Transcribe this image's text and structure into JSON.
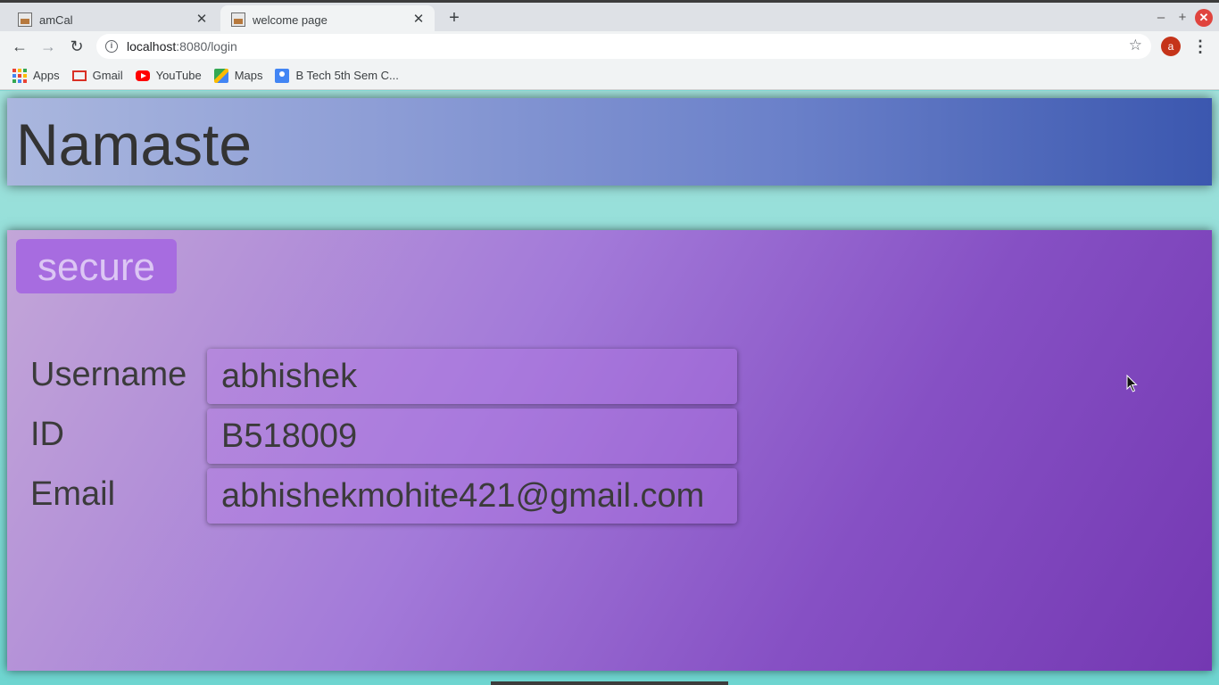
{
  "browser": {
    "tabs": [
      {
        "title": "amCal",
        "active": false
      },
      {
        "title": "welcome page",
        "active": true
      }
    ],
    "url_host": "localhost",
    "url_path": ":8080/login",
    "profile_initial": "a",
    "bookmarks": [
      {
        "label": "Apps",
        "icon": "apps-grid-icon"
      },
      {
        "label": "Gmail",
        "icon": "gmail-icon"
      },
      {
        "label": "YouTube",
        "icon": "youtube-icon"
      },
      {
        "label": "Maps",
        "icon": "maps-icon"
      },
      {
        "label": "B Tech 5th Sem C...",
        "icon": "classroom-icon"
      }
    ]
  },
  "page": {
    "banner_title": "Namaste",
    "badge_label": "secure",
    "form": {
      "username_label": "Username",
      "username_value": "abhishek",
      "id_label": "ID",
      "id_value": "B518009",
      "email_label": "Email",
      "email_value": "abhishekmohite421@gmail.com"
    }
  },
  "colors": {
    "banner_gradient": [
      "#aab7de",
      "#3b57af"
    ],
    "card_gradient": [
      "#c3a6d8",
      "#7438b2"
    ],
    "badge_bg": "#a76ce0",
    "page_bg": "#7fd6d2"
  }
}
